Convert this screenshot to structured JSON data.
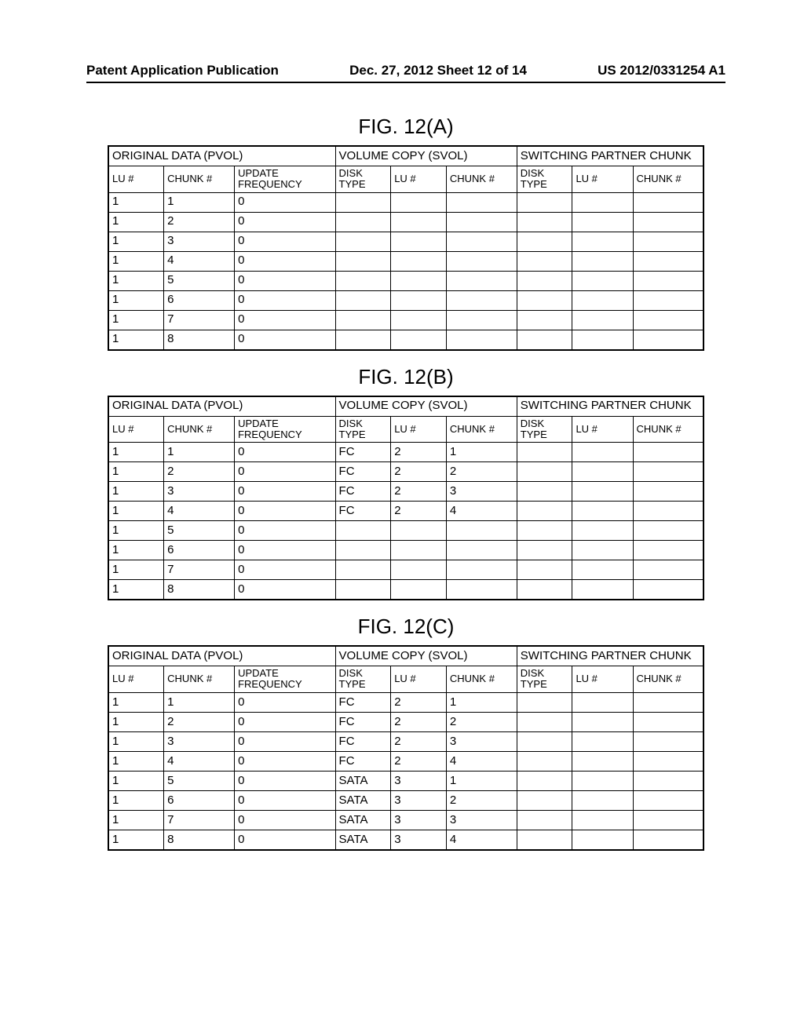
{
  "header": {
    "left": "Patent Application Publication",
    "mid": "Dec. 27, 2012  Sheet 12 of 14",
    "right": "US 2012/0331254 A1"
  },
  "captions": {
    "a": "FIG. 12(A)",
    "b": "FIG. 12(B)",
    "c": "FIG. 12(C)"
  },
  "groupHeaders": {
    "pvol": "ORIGINAL DATA (PVOL)",
    "svol": "VOLUME COPY (SVOL)",
    "switch": "SWITCHING PARTNER CHUNK"
  },
  "colHeaders": {
    "lu": "LU #",
    "chunk": "CHUNK #",
    "update": "UPDATE FREQUENCY",
    "disk": "DISK TYPE"
  },
  "tableA": {
    "rows": [
      {
        "lu": "1",
        "chunk": "1",
        "upd": "0",
        "sdisk": "",
        "slu": "",
        "schunk": "",
        "pdisk": "",
        "plu": "",
        "pchunk": ""
      },
      {
        "lu": "1",
        "chunk": "2",
        "upd": "0",
        "sdisk": "",
        "slu": "",
        "schunk": "",
        "pdisk": "",
        "plu": "",
        "pchunk": ""
      },
      {
        "lu": "1",
        "chunk": "3",
        "upd": "0",
        "sdisk": "",
        "slu": "",
        "schunk": "",
        "pdisk": "",
        "plu": "",
        "pchunk": ""
      },
      {
        "lu": "1",
        "chunk": "4",
        "upd": "0",
        "sdisk": "",
        "slu": "",
        "schunk": "",
        "pdisk": "",
        "plu": "",
        "pchunk": ""
      },
      {
        "lu": "1",
        "chunk": "5",
        "upd": "0",
        "sdisk": "",
        "slu": "",
        "schunk": "",
        "pdisk": "",
        "plu": "",
        "pchunk": ""
      },
      {
        "lu": "1",
        "chunk": "6",
        "upd": "0",
        "sdisk": "",
        "slu": "",
        "schunk": "",
        "pdisk": "",
        "plu": "",
        "pchunk": ""
      },
      {
        "lu": "1",
        "chunk": "7",
        "upd": "0",
        "sdisk": "",
        "slu": "",
        "schunk": "",
        "pdisk": "",
        "plu": "",
        "pchunk": ""
      },
      {
        "lu": "1",
        "chunk": "8",
        "upd": "0",
        "sdisk": "",
        "slu": "",
        "schunk": "",
        "pdisk": "",
        "plu": "",
        "pchunk": ""
      }
    ]
  },
  "tableB": {
    "rows": [
      {
        "lu": "1",
        "chunk": "1",
        "upd": "0",
        "sdisk": "FC",
        "slu": "2",
        "schunk": "1",
        "pdisk": "",
        "plu": "",
        "pchunk": ""
      },
      {
        "lu": "1",
        "chunk": "2",
        "upd": "0",
        "sdisk": "FC",
        "slu": "2",
        "schunk": "2",
        "pdisk": "",
        "plu": "",
        "pchunk": ""
      },
      {
        "lu": "1",
        "chunk": "3",
        "upd": "0",
        "sdisk": "FC",
        "slu": "2",
        "schunk": "3",
        "pdisk": "",
        "plu": "",
        "pchunk": ""
      },
      {
        "lu": "1",
        "chunk": "4",
        "upd": "0",
        "sdisk": "FC",
        "slu": "2",
        "schunk": "4",
        "pdisk": "",
        "plu": "",
        "pchunk": ""
      },
      {
        "lu": "1",
        "chunk": "5",
        "upd": "0",
        "sdisk": "",
        "slu": "",
        "schunk": "",
        "pdisk": "",
        "plu": "",
        "pchunk": ""
      },
      {
        "lu": "1",
        "chunk": "6",
        "upd": "0",
        "sdisk": "",
        "slu": "",
        "schunk": "",
        "pdisk": "",
        "plu": "",
        "pchunk": ""
      },
      {
        "lu": "1",
        "chunk": "7",
        "upd": "0",
        "sdisk": "",
        "slu": "",
        "schunk": "",
        "pdisk": "",
        "plu": "",
        "pchunk": ""
      },
      {
        "lu": "1",
        "chunk": "8",
        "upd": "0",
        "sdisk": "",
        "slu": "",
        "schunk": "",
        "pdisk": "",
        "plu": "",
        "pchunk": ""
      }
    ]
  },
  "tableC": {
    "rows": [
      {
        "lu": "1",
        "chunk": "1",
        "upd": "0",
        "sdisk": "FC",
        "slu": "2",
        "schunk": "1",
        "pdisk": "",
        "plu": "",
        "pchunk": ""
      },
      {
        "lu": "1",
        "chunk": "2",
        "upd": "0",
        "sdisk": "FC",
        "slu": "2",
        "schunk": "2",
        "pdisk": "",
        "plu": "",
        "pchunk": ""
      },
      {
        "lu": "1",
        "chunk": "3",
        "upd": "0",
        "sdisk": "FC",
        "slu": "2",
        "schunk": "3",
        "pdisk": "",
        "plu": "",
        "pchunk": ""
      },
      {
        "lu": "1",
        "chunk": "4",
        "upd": "0",
        "sdisk": "FC",
        "slu": "2",
        "schunk": "4",
        "pdisk": "",
        "plu": "",
        "pchunk": ""
      },
      {
        "lu": "1",
        "chunk": "5",
        "upd": "0",
        "sdisk": "SATA",
        "slu": "3",
        "schunk": "1",
        "pdisk": "",
        "plu": "",
        "pchunk": ""
      },
      {
        "lu": "1",
        "chunk": "6",
        "upd": "0",
        "sdisk": "SATA",
        "slu": "3",
        "schunk": "2",
        "pdisk": "",
        "plu": "",
        "pchunk": ""
      },
      {
        "lu": "1",
        "chunk": "7",
        "upd": "0",
        "sdisk": "SATA",
        "slu": "3",
        "schunk": "3",
        "pdisk": "",
        "plu": "",
        "pchunk": ""
      },
      {
        "lu": "1",
        "chunk": "8",
        "upd": "0",
        "sdisk": "SATA",
        "slu": "3",
        "schunk": "4",
        "pdisk": "",
        "plu": "",
        "pchunk": ""
      }
    ]
  }
}
